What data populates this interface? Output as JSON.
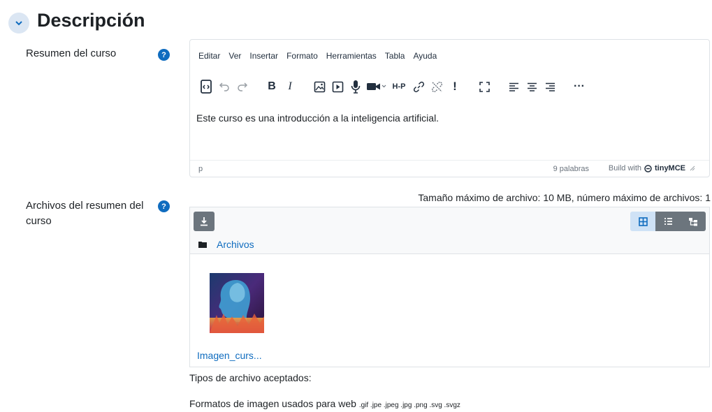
{
  "section": {
    "title": "Descripción"
  },
  "summary": {
    "label": "Resumen del curso",
    "menu": [
      "Editar",
      "Ver",
      "Insertar",
      "Formato",
      "Herramientas",
      "Tabla",
      "Ayuda"
    ],
    "content": "Este curso es una introducción a la inteligencia artificial.",
    "status_path": "p",
    "word_count": "9 palabras",
    "build_with": "Build with",
    "brand": "tinyMCE"
  },
  "files": {
    "label": "Archivos del resumen del curso",
    "max_info": "Tamaño máximo de archivo: 10 MB, número máximo de archivos: 1",
    "folder": "Archivos",
    "file_name": "Imagen_curs...",
    "accepted_title": "Tipos de archivo aceptados:",
    "accepted_desc": "Formatos de imagen usados para web",
    "accepted_ext": ".gif .jpe .jpeg .jpg .png .svg .svgz"
  },
  "colors": {
    "accent": "#0f6cbf",
    "toggle_bg": "#dbe6f3"
  }
}
